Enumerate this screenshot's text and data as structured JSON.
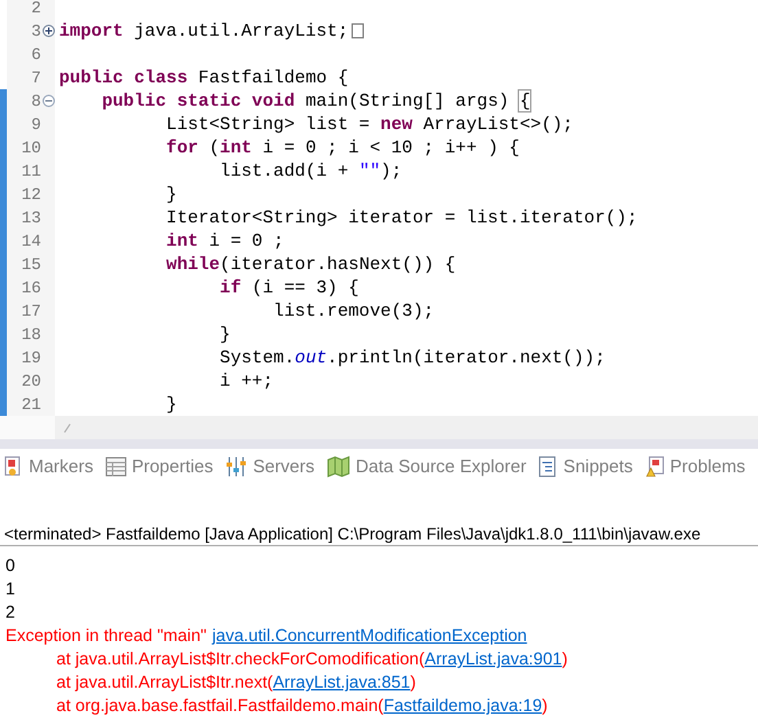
{
  "editor": {
    "lines": [
      {
        "number": "2",
        "changed": false
      },
      {
        "number": "3",
        "folded": true,
        "changed": false,
        "tokens": [
          {
            "text": "import",
            "kind": "keyword"
          },
          {
            "text": " java.util.ArrayList;",
            "kind": "plain"
          }
        ],
        "collapsed": true
      },
      {
        "number": "6",
        "changed": false
      },
      {
        "number": "7",
        "changed": false,
        "tokens": [
          {
            "text": "public class",
            "kind": "keyword"
          },
          {
            "text": " Fastfaildemo {",
            "kind": "plain"
          }
        ]
      },
      {
        "number": "8",
        "folded": false,
        "changed": true,
        "tokens": [
          {
            "text": "    public static void",
            "kind": "keyword"
          },
          {
            "text": " main(String[] args) ",
            "kind": "plain"
          },
          {
            "text": "{",
            "kind": "match"
          }
        ]
      },
      {
        "number": "9",
        "changed": true,
        "tokens": [
          {
            "text": "          List<String> list = ",
            "kind": "plain"
          },
          {
            "text": "new",
            "kind": "keyword"
          },
          {
            "text": " ArrayList<>();",
            "kind": "plain"
          }
        ]
      },
      {
        "number": "10",
        "changed": true,
        "tokens": [
          {
            "text": "          for",
            "kind": "keyword"
          },
          {
            "text": " (",
            "kind": "plain"
          },
          {
            "text": "int",
            "kind": "keyword"
          },
          {
            "text": " i = 0 ; i < 10 ; i++ ) {",
            "kind": "plain"
          }
        ]
      },
      {
        "number": "11",
        "changed": true,
        "tokens": [
          {
            "text": "               list.add(i + ",
            "kind": "plain"
          },
          {
            "text": "\"\"",
            "kind": "string"
          },
          {
            "text": ");",
            "kind": "plain"
          }
        ]
      },
      {
        "number": "12",
        "changed": true,
        "tokens": [
          {
            "text": "          }",
            "kind": "plain"
          }
        ]
      },
      {
        "number": "13",
        "changed": true,
        "tokens": [
          {
            "text": "          Iterator<String> iterator = list.iterator();",
            "kind": "plain"
          }
        ]
      },
      {
        "number": "14",
        "changed": true,
        "tokens": [
          {
            "text": "          int",
            "kind": "keyword"
          },
          {
            "text": " i = 0 ;",
            "kind": "plain"
          }
        ]
      },
      {
        "number": "15",
        "changed": true,
        "tokens": [
          {
            "text": "          while",
            "kind": "keyword"
          },
          {
            "text": "(iterator.hasNext()) {",
            "kind": "plain"
          }
        ]
      },
      {
        "number": "16",
        "changed": true,
        "tokens": [
          {
            "text": "               if",
            "kind": "keyword"
          },
          {
            "text": " (i == 3) {",
            "kind": "plain"
          }
        ]
      },
      {
        "number": "17",
        "changed": true,
        "tokens": [
          {
            "text": "                    list.remove(3);",
            "kind": "plain"
          }
        ]
      },
      {
        "number": "18",
        "changed": true,
        "tokens": [
          {
            "text": "               }",
            "kind": "plain"
          }
        ]
      },
      {
        "number": "19",
        "changed": true,
        "tokens": [
          {
            "text": "               System.",
            "kind": "plain"
          },
          {
            "text": "out",
            "kind": "field"
          },
          {
            "text": ".println(iterator.next());",
            "kind": "plain"
          }
        ]
      },
      {
        "number": "20",
        "changed": true,
        "tokens": [
          {
            "text": "               i ++;",
            "kind": "plain"
          }
        ]
      },
      {
        "number": "21",
        "changed": true,
        "tokens": [
          {
            "text": "          }",
            "kind": "plain"
          }
        ]
      }
    ]
  },
  "tabs": [
    {
      "label": "Markers",
      "kind": "markers"
    },
    {
      "label": "Properties",
      "kind": "properties"
    },
    {
      "label": "Servers",
      "kind": "servers"
    },
    {
      "label": "Data Source Explorer",
      "kind": "datasource"
    },
    {
      "label": "Snippets",
      "kind": "snippets"
    },
    {
      "label": "Problems",
      "kind": "problems"
    }
  ],
  "console": {
    "header": "<terminated> Fastfaildemo [Java Application] C:\\Program Files\\Java\\jdk1.8.0_111\\bin\\javaw.exe",
    "lines": [
      {
        "kind": "out",
        "segments": [
          {
            "text": "0",
            "link": false
          }
        ]
      },
      {
        "kind": "out",
        "segments": [
          {
            "text": "1",
            "link": false
          }
        ]
      },
      {
        "kind": "out",
        "segments": [
          {
            "text": "2",
            "link": false
          }
        ]
      },
      {
        "kind": "error",
        "segments": [
          {
            "text": "Exception in thread \"main\"",
            "link": false
          },
          {
            "text": "java.util.ConcurrentModificationException",
            "link": true
          }
        ]
      },
      {
        "kind": "trace",
        "segments": [
          {
            "text": "at java.util.ArrayList$Itr.checkForComodification(",
            "link": false
          },
          {
            "text": "ArrayList.java:901",
            "link": true
          },
          {
            "text": ")",
            "link": false
          }
        ]
      },
      {
        "kind": "trace",
        "segments": [
          {
            "text": "at java.util.ArrayList$Itr.next(",
            "link": false
          },
          {
            "text": "ArrayList.java:851",
            "link": true
          },
          {
            "text": ")",
            "link": false
          }
        ]
      },
      {
        "kind": "trace",
        "segments": [
          {
            "text": "at org.java.base.fastfail.Fastfaildemo.main(",
            "link": false
          },
          {
            "text": "Fastfaildemo.java:19",
            "link": true
          },
          {
            "text": ")",
            "link": false
          }
        ]
      }
    ]
  }
}
